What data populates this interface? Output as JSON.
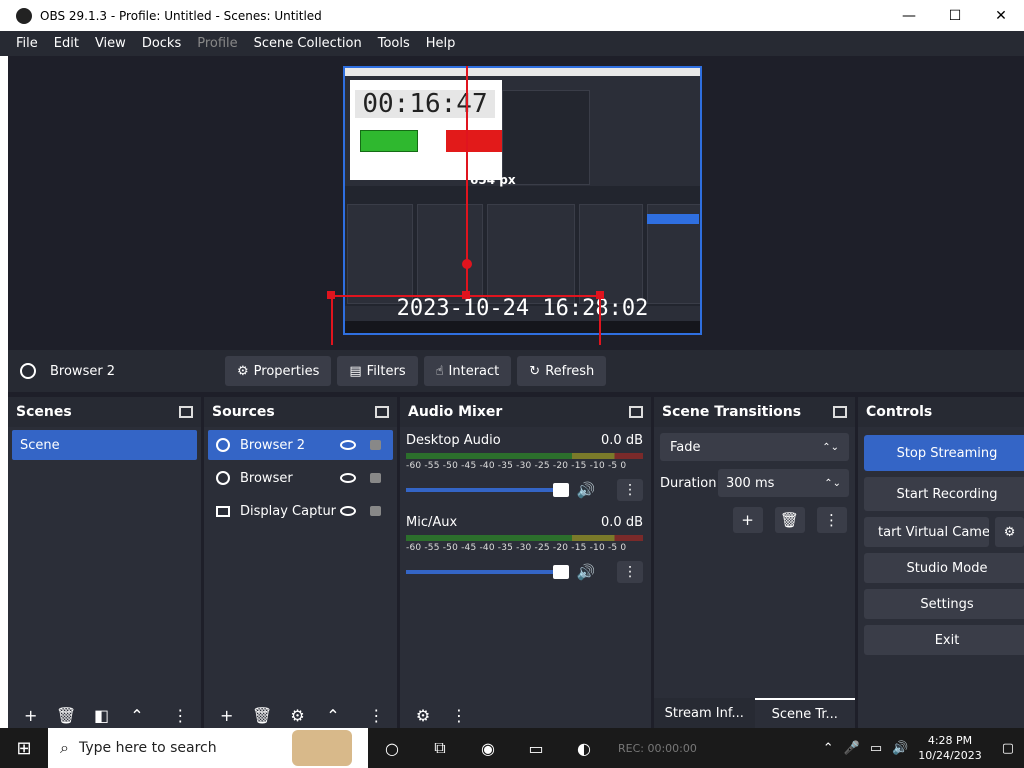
{
  "window": {
    "title": "OBS 29.1.3 - Profile: Untitled - Scenes: Untitled",
    "minimize": "—",
    "maximize": "☐",
    "close": "✕"
  },
  "menu": [
    "File",
    "Edit",
    "View",
    "Docks",
    "Profile",
    "Scene Collection",
    "Tools",
    "Help"
  ],
  "preview": {
    "timer": "00:16:47",
    "clock": "2023-10-24 16:28:02",
    "size_label": "654 px"
  },
  "source_toolbar": {
    "name": "Browser 2",
    "properties": "Properties",
    "filters": "Filters",
    "interact": "Interact",
    "refresh": "Refresh"
  },
  "scenes": {
    "title": "Scenes",
    "items": [
      "Scene"
    ]
  },
  "sources": {
    "title": "Sources",
    "items": [
      "Browser 2",
      "Browser",
      "Display Captur"
    ]
  },
  "audio": {
    "title": "Audio Mixer",
    "scale": "-60 -55 -50 -45 -40 -35 -30 -25 -20 -15 -10 -5 0",
    "tracks": [
      {
        "name": "Desktop Audio",
        "level": "0.0 dB"
      },
      {
        "name": "Mic/Aux",
        "level": "0.0 dB"
      }
    ]
  },
  "transitions": {
    "title": "Scene Transitions",
    "selected": "Fade",
    "duration_label": "Duration",
    "duration_value": "300 ms",
    "tabs": [
      "Stream Inf...",
      "Scene Tr..."
    ]
  },
  "controls": {
    "title": "Controls",
    "stop_streaming": "Stop Streaming",
    "start_recording": "Start Recording",
    "virtual_camera": "tart Virtual Camer",
    "studio_mode": "Studio Mode",
    "settings": "Settings",
    "exit": "Exit"
  },
  "taskbar": {
    "search_placeholder": "Type here to search",
    "status": "REC: 00:00:00",
    "time": "4:28 PM",
    "date": "10/24/2023"
  }
}
